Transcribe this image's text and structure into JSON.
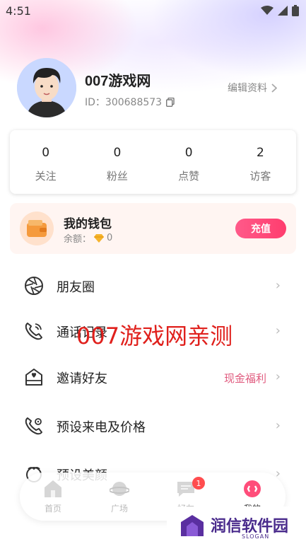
{
  "status_bar": {
    "time": "4:51"
  },
  "profile": {
    "username": "007游戏网",
    "id_text": "ID：300688573",
    "edit_label": "编辑资料"
  },
  "stats": [
    {
      "value": "0",
      "label": "关注"
    },
    {
      "value": "0",
      "label": "粉丝"
    },
    {
      "value": "0",
      "label": "点赞"
    },
    {
      "value": "2",
      "label": "访客"
    }
  ],
  "wallet": {
    "title": "我的钱包",
    "balance_label": "余额：",
    "balance_value": "0",
    "recharge_label": "充值"
  },
  "menu": [
    {
      "label": "朋友圈",
      "icon": "aperture-icon",
      "extra": ""
    },
    {
      "label": "通话记录",
      "icon": "phone-call-icon",
      "extra": ""
    },
    {
      "label": "邀请好友",
      "icon": "invite-mail-icon",
      "extra": "现金福利"
    },
    {
      "label": "预设来电及价格",
      "icon": "phone-settings-icon",
      "extra": ""
    },
    {
      "label": "预设美颜",
      "icon": "beauty-icon",
      "extra": ""
    }
  ],
  "watermark": "007游戏网亲测",
  "bottom_nav": [
    {
      "label": "首页",
      "icon": "home-icon"
    },
    {
      "label": "广场",
      "icon": "planet-icon"
    },
    {
      "label": "好友",
      "icon": "chat-icon",
      "badge": "1"
    },
    {
      "label": "我的",
      "icon": "profile-icon"
    }
  ],
  "logo": {
    "text": "润信软件园",
    "sub": "SLOGAN"
  },
  "colors": {
    "accent": "#ff4d7a",
    "invite_extra": "#e05a7e",
    "watermark": "#e0201c",
    "logo": "#4a2b8c"
  }
}
